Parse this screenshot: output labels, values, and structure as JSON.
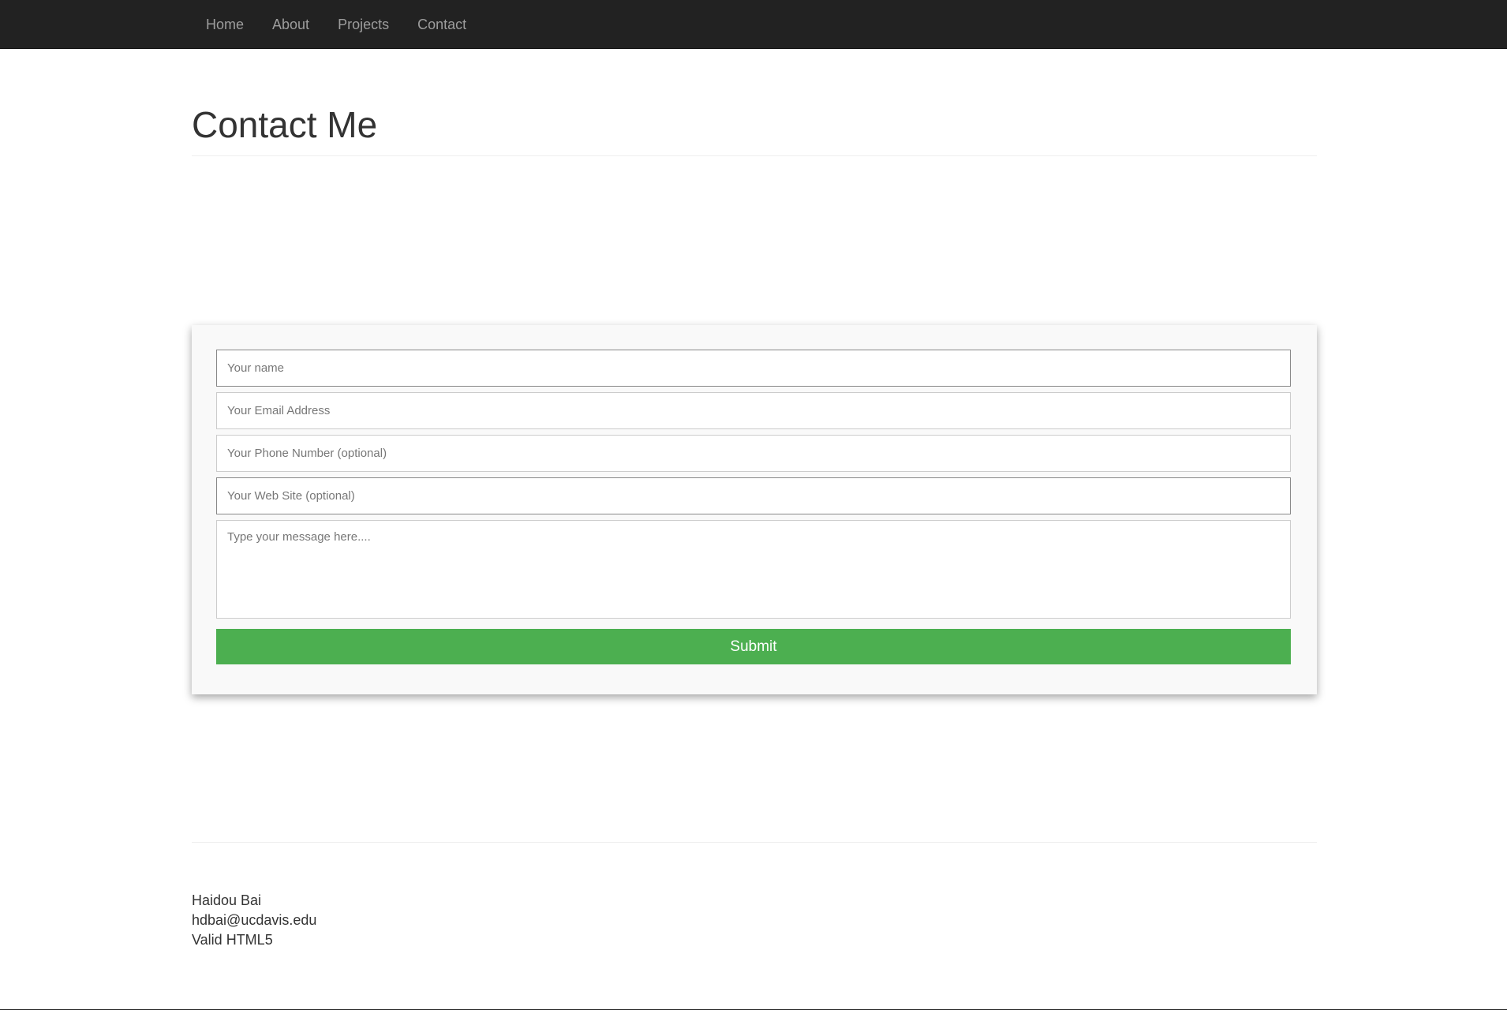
{
  "nav": {
    "items": [
      {
        "label": "Home"
      },
      {
        "label": "About"
      },
      {
        "label": "Projects"
      },
      {
        "label": "Contact"
      }
    ]
  },
  "header": {
    "title": "Contact Me"
  },
  "form": {
    "name_placeholder": "Your name",
    "email_placeholder": "Your Email Address",
    "phone_placeholder": "Your Phone Number (optional)",
    "website_placeholder": "Your Web Site (optional)",
    "message_placeholder": "Type your message here....",
    "submit_label": "Submit",
    "submit_color": "#4caf50"
  },
  "footer": {
    "name": "Haidou Bai",
    "email": "hdbai@ucdavis.edu",
    "validation": "Valid HTML5"
  },
  "colors": {
    "navbar_bg": "#222222",
    "nav_text": "#9d9d9d",
    "card_bg": "#f9f9f9"
  }
}
